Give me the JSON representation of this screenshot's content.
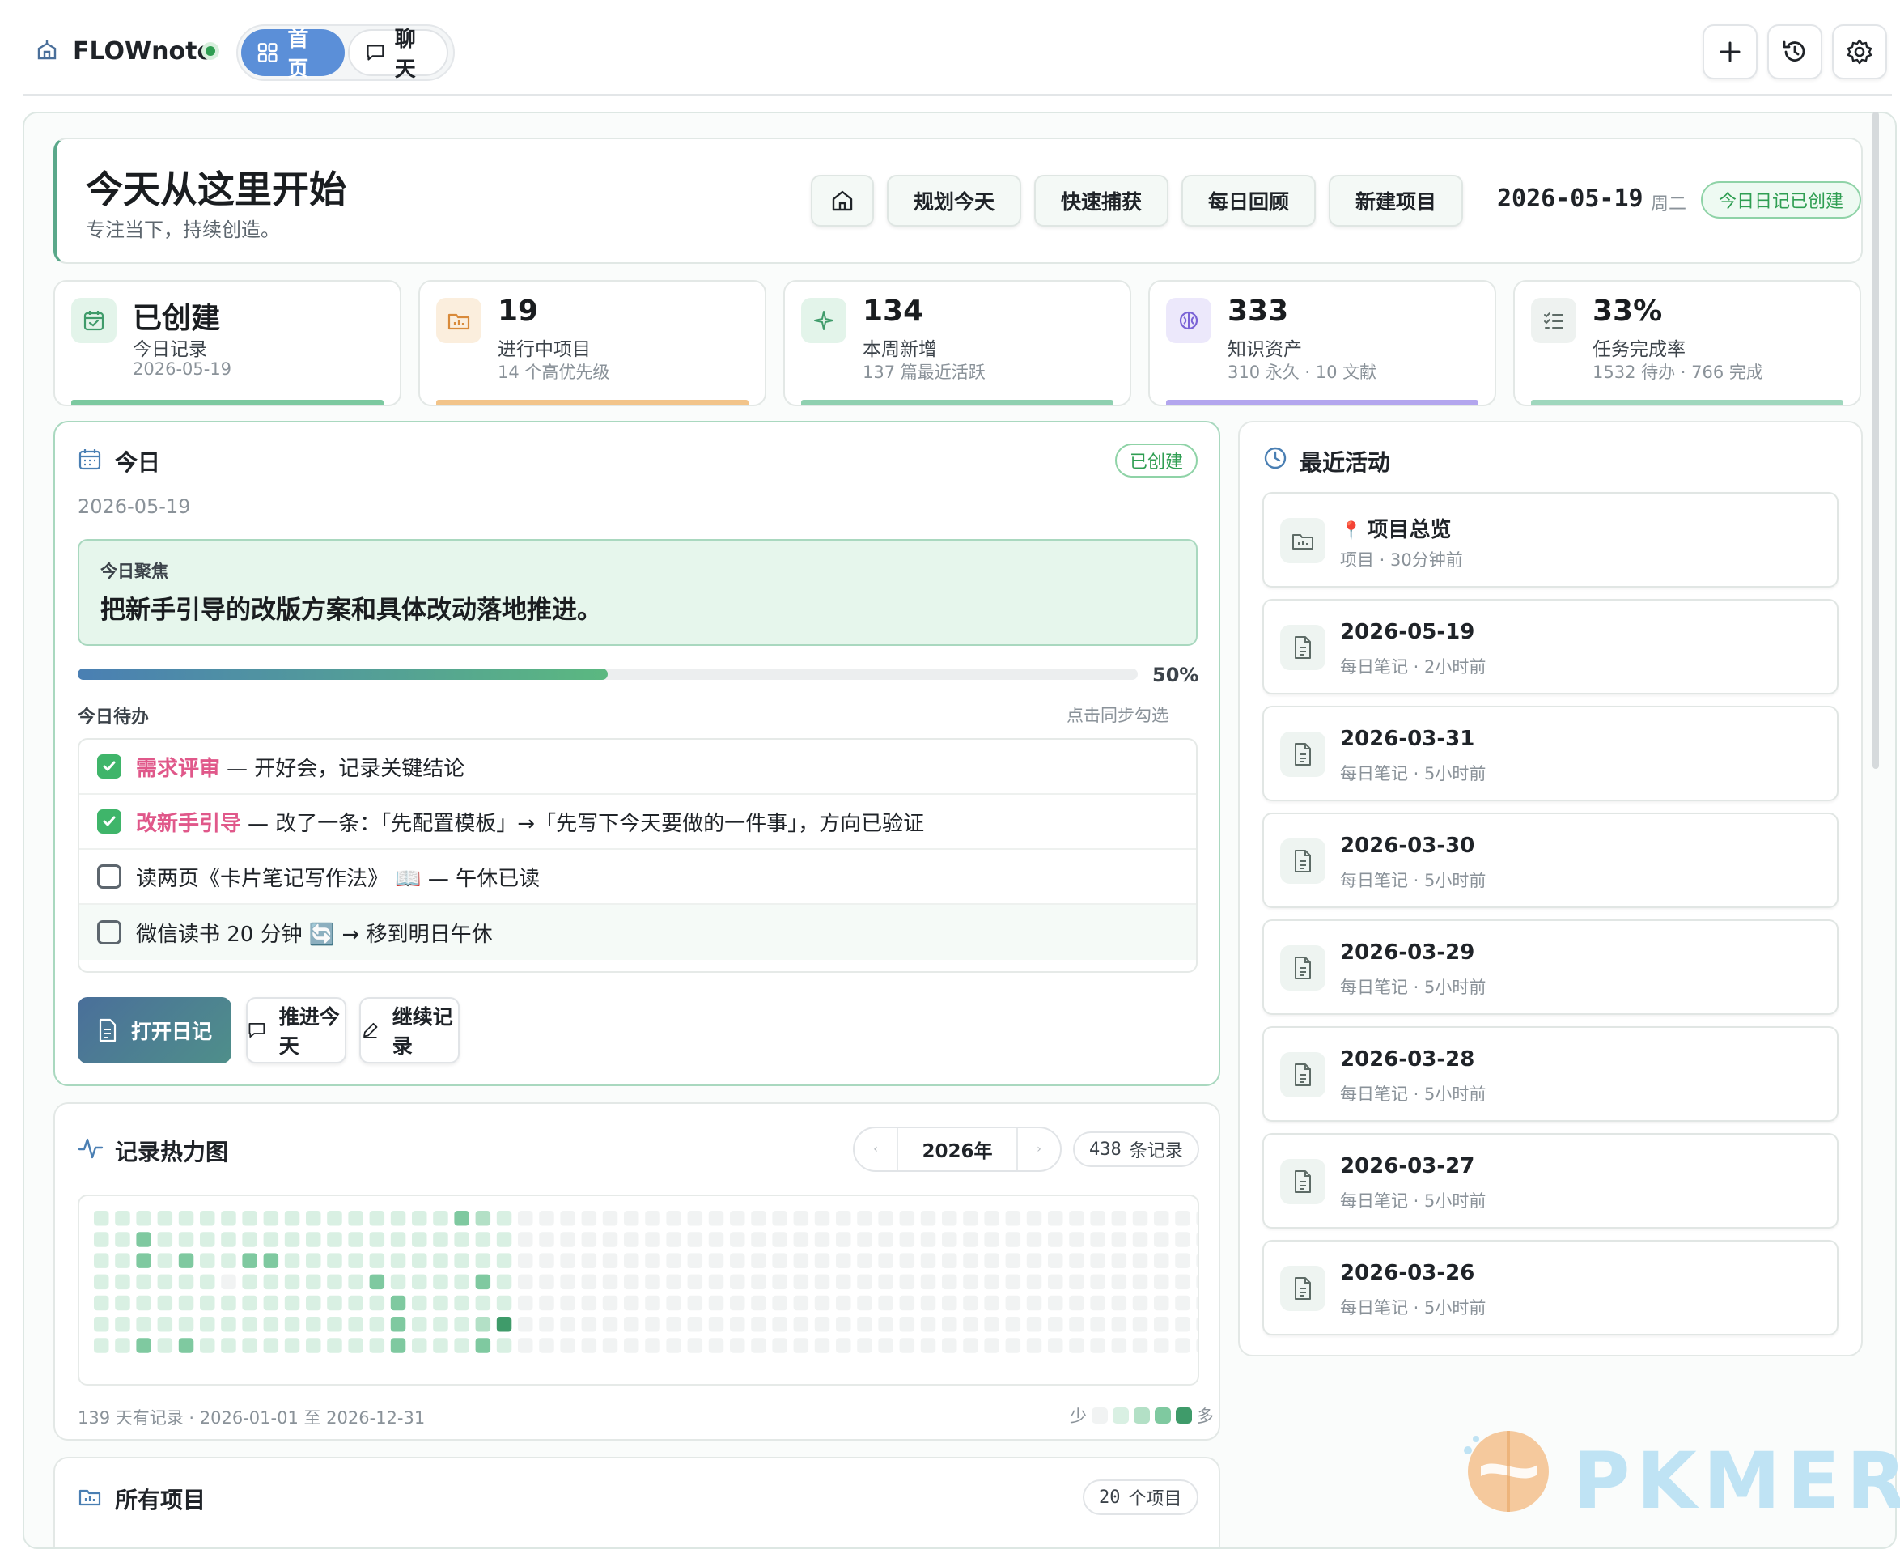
{
  "app": {
    "name": "FLOWnote",
    "nav": [
      {
        "label": "首页",
        "active": true,
        "icon": "grid-icon"
      },
      {
        "label": "聊天",
        "active": false,
        "icon": "chat-icon"
      }
    ],
    "actions": [
      {
        "name": "add-icon"
      },
      {
        "name": "history-icon"
      },
      {
        "name": "settings-icon"
      }
    ]
  },
  "hero": {
    "title": "今天从这里开始",
    "subtitle": "专注当下，持续创造。",
    "buttons": [
      "规划今天",
      "快速捕获",
      "每日回顾",
      "新建项目"
    ],
    "date": "2026-05-19",
    "weekday": "周二",
    "badge": "今日日记已创建"
  },
  "stats": [
    {
      "value": "已创建",
      "label": "今日记录",
      "detail": "2026-05-19",
      "accent": "#7cc9a0",
      "icon": "calendar-check-icon"
    },
    {
      "value": "19",
      "label": "进行中项目",
      "detail": "14 个高优先级",
      "accent": "#f2c48a",
      "icon": "folder-chart-icon"
    },
    {
      "value": "134",
      "label": "本周新增",
      "detail": "137 篇最近活跃",
      "accent": "#8fd0b0",
      "icon": "sparkle-icon"
    },
    {
      "value": "333",
      "label": "知识资产",
      "detail": "310 永久 · 10 文献",
      "accent": "#b3a6ee",
      "icon": "brain-icon"
    },
    {
      "value": "33%",
      "label": "任务完成率",
      "detail": "1532 待办 · 766 完成",
      "accent": "#9fd7bd",
      "icon": "checklist-icon"
    }
  ],
  "today": {
    "title": "今日",
    "badge": "已创建",
    "date": "2026-05-19",
    "focus_label": "今日聚焦",
    "focus_text": "把新手引导的改版方案和具体改动落地推进。",
    "progress": 0.5,
    "progress_label": "50%",
    "todo_header": "今日待办",
    "todo_hint": "点击同步勾选",
    "todos": [
      {
        "done": true,
        "tag": "需求评审",
        "text": "— 开好会，记录关键结论"
      },
      {
        "done": true,
        "tag": "改新手引导",
        "text": "— 改了一条：「先配置模板」→「先写下今天要做的一件事」，方向已验证"
      },
      {
        "done": false,
        "tag": "",
        "text": "读两页《卡片笔记写作法》 📖 — 午休已读"
      },
      {
        "done": false,
        "tag": "",
        "text": "微信读书 20 分钟 🔄 → 移到明日午休"
      }
    ],
    "actions": [
      "打开日记",
      "推进今天",
      "继续记录"
    ]
  },
  "heatmap": {
    "title": "记录热力图",
    "year": "2026年",
    "prev": "‹",
    "next": "›",
    "count_num": "438",
    "count_unit": "条记录",
    "footer": "139 天有记录 · 2026-01-01 至 2026-12-31",
    "legend_less": "少",
    "legend_more": "多",
    "palette": [
      "#f1f3f3",
      "#d9f0e3",
      "#b3e0c6",
      "#7fc9a0",
      "#3f9b6a"
    ],
    "weeks": 52,
    "levels": [
      "11111111111111111321000000000000000000000000000000000",
      "11311111111111111111000000000000000000000000000000000",
      "11313113311111111111000000000000000000000000000000000",
      "11111101111113111131000000000000000000000000000000000",
      "11111111111111311111000000000000000000000000000000000",
      "11111111111111311124000000000000000000000000000000000",
      "11313111111111311131000000000000000000000000000000000"
    ]
  },
  "projects": {
    "title": "所有项目",
    "count_num": "20",
    "count_unit": "个项目"
  },
  "recent": {
    "title": "最近活动",
    "items": [
      {
        "pin": "📍",
        "title": "项目总览",
        "meta": "项目 · 30分钟前",
        "icon": "folder-chart-icon"
      },
      {
        "pin": "",
        "title": "2026-05-19",
        "meta": "每日笔记 · 2小时前",
        "icon": "document-icon"
      },
      {
        "pin": "",
        "title": "2026-03-31",
        "meta": "每日笔记 · 5小时前",
        "icon": "document-icon"
      },
      {
        "pin": "",
        "title": "2026-03-30",
        "meta": "每日笔记 · 5小时前",
        "icon": "document-icon"
      },
      {
        "pin": "",
        "title": "2026-03-29",
        "meta": "每日笔记 · 5小时前",
        "icon": "document-icon"
      },
      {
        "pin": "",
        "title": "2026-03-28",
        "meta": "每日笔记 · 5小时前",
        "icon": "document-icon"
      },
      {
        "pin": "",
        "title": "2026-03-27",
        "meta": "每日笔记 · 5小时前",
        "icon": "document-icon"
      },
      {
        "pin": "",
        "title": "2026-03-26",
        "meta": "每日笔记 · 5小时前",
        "icon": "document-icon"
      }
    ]
  },
  "watermark": "PKMER"
}
